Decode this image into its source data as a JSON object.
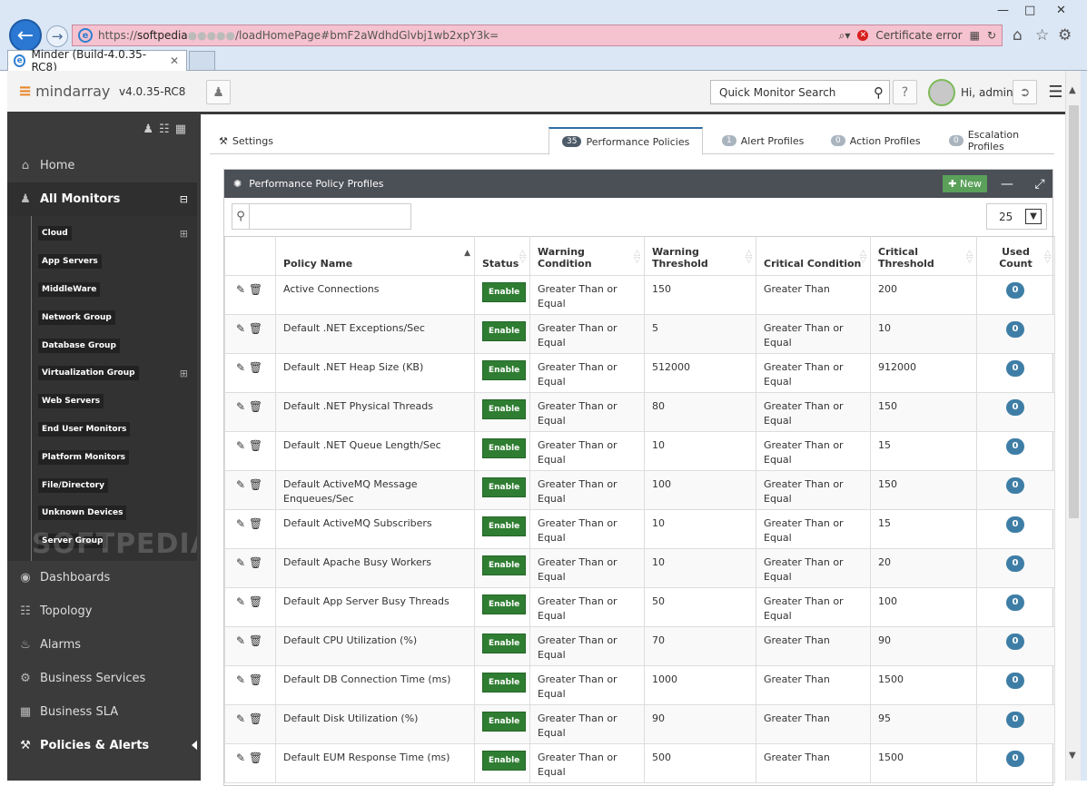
{
  "browser": {
    "url_scheme": "https://",
    "url_host": "softpedia",
    "url_path": "/loadHomePage#bmF2aWdhdGlvbj1wb2xpY3k=",
    "cert_error": "Certificate error",
    "tab_title": "Minder (Build-4.0.35-RC8)"
  },
  "app": {
    "logo": "mindarray",
    "version": "v4.0.35-RC8",
    "search_placeholder": "Quick Monitor Search",
    "help": "?",
    "greeting": "Hi, admin"
  },
  "sidebar": {
    "home": "Home",
    "all_monitors": "All Monitors",
    "groups": [
      "Cloud",
      "App Servers",
      "MiddleWare",
      "Network Group",
      "Database Group",
      "Virtualization Group",
      "Web Servers",
      "End User Monitors",
      "Platform Monitors",
      "File/Directory",
      "Unknown Devices",
      "Server Group"
    ],
    "dashboards": "Dashboards",
    "topology": "Topology",
    "alarms": "Alarms",
    "business_services": "Business Services",
    "business_sla": "Business SLA",
    "policies": "Policies & Alerts"
  },
  "tabs": {
    "settings": "Settings",
    "perf_count": "35",
    "perf": "Performance Policies",
    "alert_count": "1",
    "alert": "Alert Profiles",
    "action_count": "0",
    "action": "Action Profiles",
    "esc_count": "0",
    "esc": "Escalation Profiles"
  },
  "panel": {
    "title": "Performance Policy Profiles",
    "new": "New",
    "page_size": "25"
  },
  "table": {
    "headers": [
      "Policy Name",
      "Status",
      "Warning Condition",
      "Warning Threshold",
      "Critical Condition",
      "Critical Threshold",
      "Used Count"
    ],
    "rows": [
      [
        "Active Connections",
        "Enable",
        "Greater Than or Equal",
        "150",
        "Greater Than",
        "200",
        "0"
      ],
      [
        "Default .NET Exceptions/Sec",
        "Enable",
        "Greater Than or Equal",
        "5",
        "Greater Than or Equal",
        "10",
        "0"
      ],
      [
        "Default .NET Heap Size (KB)",
        "Enable",
        "Greater Than or Equal",
        "512000",
        "Greater Than or Equal",
        "912000",
        "0"
      ],
      [
        "Default .NET Physical Threads",
        "Enable",
        "Greater Than or Equal",
        "80",
        "Greater Than or Equal",
        "150",
        "0"
      ],
      [
        "Default .NET Queue Length/Sec",
        "Enable",
        "Greater Than or Equal",
        "10",
        "Greater Than or Equal",
        "15",
        "0"
      ],
      [
        "Default ActiveMQ Message Enqueues/Sec",
        "Enable",
        "Greater Than or Equal",
        "100",
        "Greater Than or Equal",
        "150",
        "0"
      ],
      [
        "Default ActiveMQ Subscribers",
        "Enable",
        "Greater Than or Equal",
        "10",
        "Greater Than or Equal",
        "15",
        "0"
      ],
      [
        "Default Apache Busy Workers",
        "Enable",
        "Greater Than or Equal",
        "10",
        "Greater Than or Equal",
        "20",
        "0"
      ],
      [
        "Default App Server Busy Threads",
        "Enable",
        "Greater Than or Equal",
        "50",
        "Greater Than or Equal",
        "100",
        "0"
      ],
      [
        "Default CPU Utilization (%)",
        "Enable",
        "Greater Than or Equal",
        "70",
        "Greater Than",
        "90",
        "0"
      ],
      [
        "Default DB Connection Time (ms)",
        "Enable",
        "Greater Than or Equal",
        "1000",
        "Greater Than",
        "1500",
        "0"
      ],
      [
        "Default Disk Utilization (%)",
        "Enable",
        "Greater Than or Equal",
        "90",
        "Greater Than",
        "95",
        "0"
      ],
      [
        "Default EUM Response Time (ms)",
        "Enable",
        "Greater Than or Equal",
        "500",
        "Greater Than",
        "1500",
        "0"
      ]
    ]
  },
  "watermark": "SOFTPEDIA"
}
